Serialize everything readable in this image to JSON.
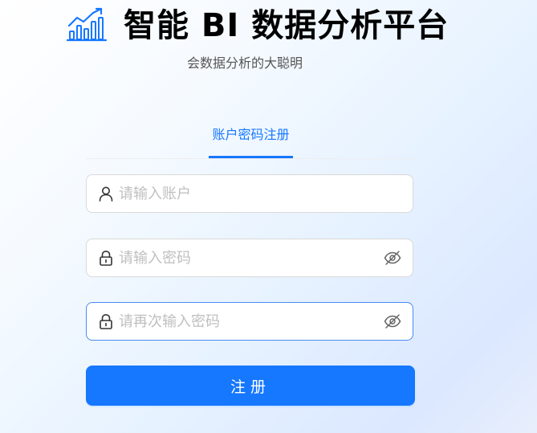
{
  "header": {
    "logo_icon": "bar-chart-trend-icon",
    "title": "智能 BI 数据分析平台",
    "subtitle": "会数据分析的大聪明"
  },
  "tabs": [
    {
      "label": "账户密码注册",
      "active": true
    }
  ],
  "form": {
    "account": {
      "icon": "user-icon",
      "placeholder": "请输入账户",
      "value": ""
    },
    "password": {
      "icon": "lock-icon",
      "placeholder": "请输入密码",
      "value": "",
      "toggle_icon": "eye-invisible-icon"
    },
    "confirm_password": {
      "icon": "lock-icon",
      "placeholder": "请再次输入密码",
      "value": "",
      "toggle_icon": "eye-invisible-icon"
    },
    "submit_label": "注册"
  },
  "colors": {
    "primary": "#1677ff",
    "title": "#000000",
    "subtitle": "#555555",
    "placeholder": "#bfbfbf"
  }
}
